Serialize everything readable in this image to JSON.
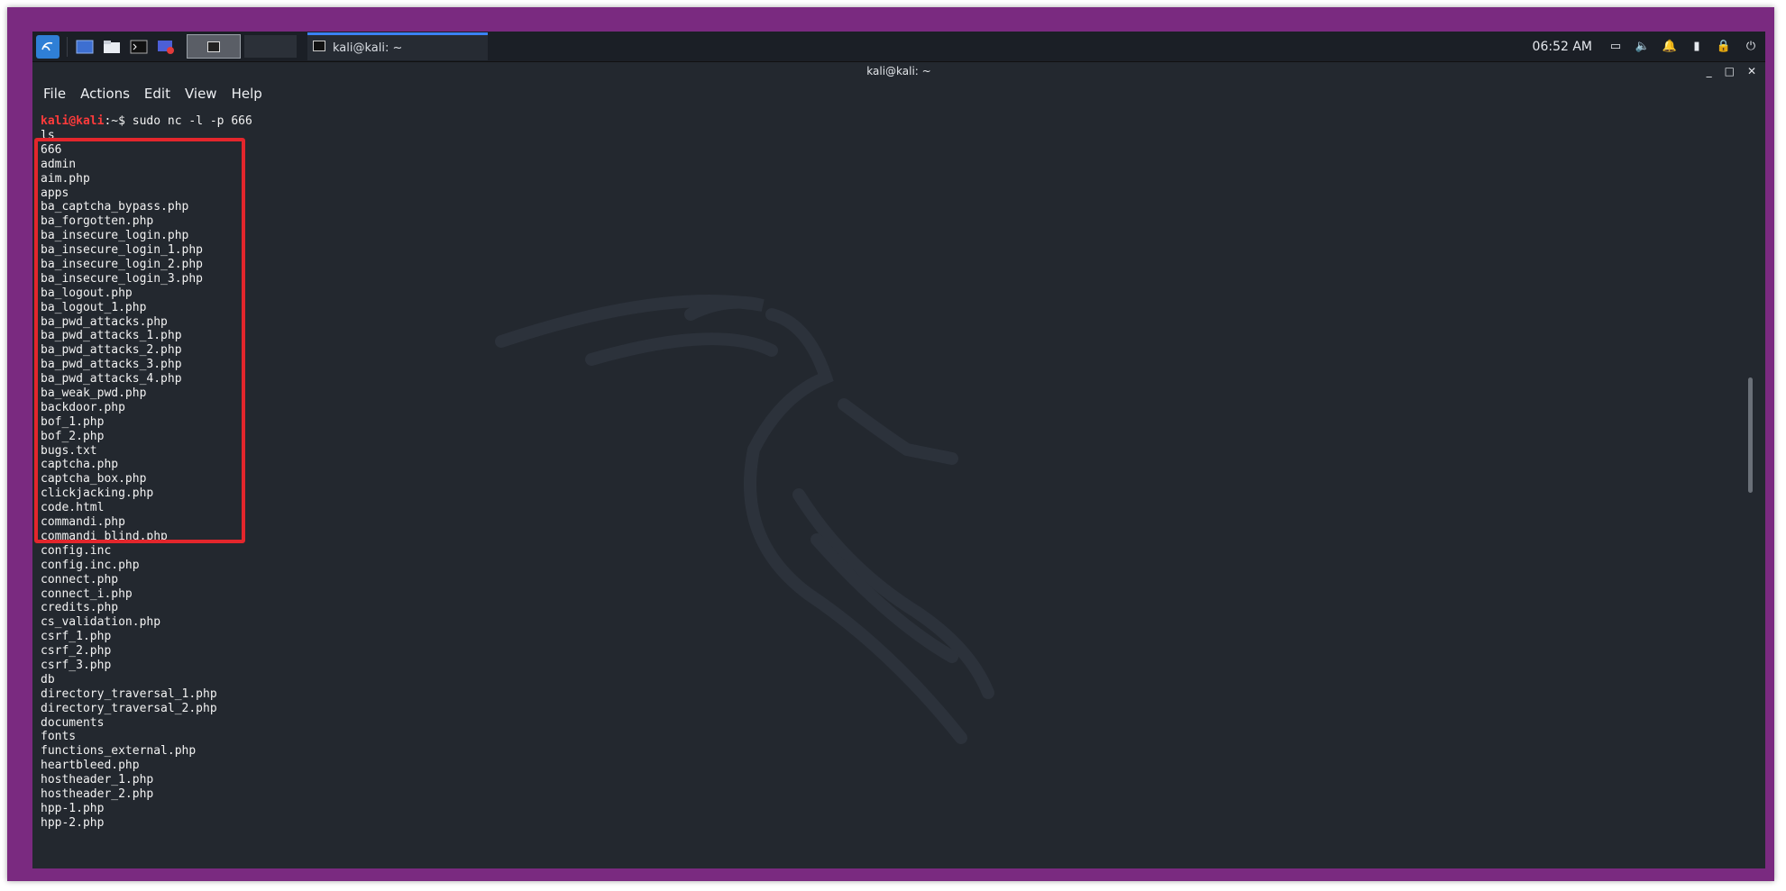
{
  "taskbar": {
    "task_title": "kali@kali: ~",
    "clock": "06:52 AM"
  },
  "window": {
    "title": "kali@kali: ~"
  },
  "menu": {
    "file": "File",
    "actions": "Actions",
    "edit": "Edit",
    "view": "View",
    "help": "Help"
  },
  "terminal": {
    "prompt_user": "kali@kali",
    "prompt_path": ":~$ ",
    "command": "sudo nc -l -p 666",
    "lines": [
      "ls",
      "666",
      "admin",
      "aim.php",
      "apps",
      "ba_captcha_bypass.php",
      "ba_forgotten.php",
      "ba_insecure_login.php",
      "ba_insecure_login_1.php",
      "ba_insecure_login_2.php",
      "ba_insecure_login_3.php",
      "ba_logout.php",
      "ba_logout_1.php",
      "ba_pwd_attacks.php",
      "ba_pwd_attacks_1.php",
      "ba_pwd_attacks_2.php",
      "ba_pwd_attacks_3.php",
      "ba_pwd_attacks_4.php",
      "ba_weak_pwd.php",
      "backdoor.php",
      "bof_1.php",
      "bof_2.php",
      "bugs.txt",
      "captcha.php",
      "captcha_box.php",
      "clickjacking.php",
      "code.html",
      "commandi.php",
      "commandi_blind.php",
      "config.inc",
      "config.inc.php",
      "connect.php",
      "connect_i.php",
      "credits.php",
      "cs_validation.php",
      "csrf_1.php",
      "csrf_2.php",
      "csrf_3.php",
      "db",
      "directory_traversal_1.php",
      "directory_traversal_2.php",
      "documents",
      "fonts",
      "functions_external.php",
      "heartbleed.php",
      "hostheader_1.php",
      "hostheader_2.php",
      "hpp-1.php",
      "hpp-2.php"
    ]
  },
  "colors": {
    "highlight": "#e3262c",
    "terminal_bg": "#23282f",
    "frame": "#7a2a80"
  }
}
